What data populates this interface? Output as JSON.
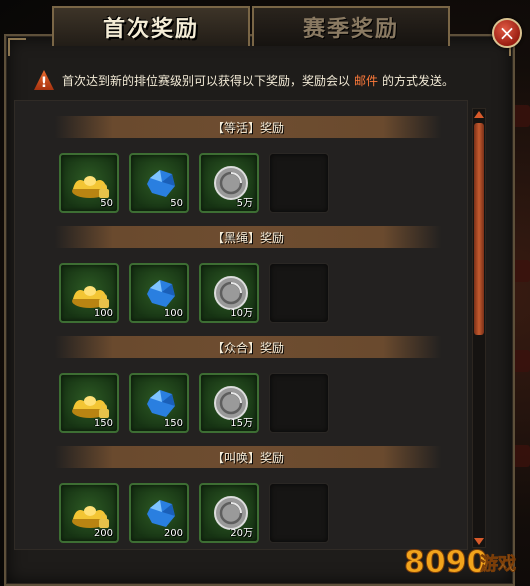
{
  "tabs": [
    {
      "label": "首次奖励",
      "active": true
    },
    {
      "label": "赛季奖励",
      "active": false
    }
  ],
  "close": {
    "glyph": "×"
  },
  "notice": {
    "pre": "首次达到新的排位赛级别可以获得以下奖励，奖励会以",
    "highlight": "邮件",
    "post": "的方式发送。",
    "highlight_color": "#ff7a3a"
  },
  "sections": [
    {
      "title": "【等活】奖励",
      "rewards": [
        {
          "icon": "gold-ingot-icon",
          "qty": "50",
          "locked": true
        },
        {
          "icon": "blue-crystal-icon",
          "qty": "50"
        },
        {
          "icon": "silver-coin-icon",
          "qty": "5万"
        }
      ]
    },
    {
      "title": "【黑绳】奖励",
      "rewards": [
        {
          "icon": "gold-ingot-icon",
          "qty": "100",
          "locked": true
        },
        {
          "icon": "blue-crystal-icon",
          "qty": "100"
        },
        {
          "icon": "silver-coin-icon",
          "qty": "10万"
        }
      ]
    },
    {
      "title": "【众合】奖励",
      "rewards": [
        {
          "icon": "gold-ingot-icon",
          "qty": "150",
          "locked": true
        },
        {
          "icon": "blue-crystal-icon",
          "qty": "150"
        },
        {
          "icon": "silver-coin-icon",
          "qty": "15万"
        }
      ]
    },
    {
      "title": "【叫唤】奖励",
      "rewards": [
        {
          "icon": "gold-ingot-icon",
          "qty": "200",
          "locked": true
        },
        {
          "icon": "blue-crystal-icon",
          "qty": "200"
        },
        {
          "icon": "silver-coin-icon",
          "qty": "20万"
        }
      ]
    }
  ],
  "watermark": {
    "digits": "8090",
    "suffix": "游戏"
  },
  "colors": {
    "accent": "#d85a2a",
    "frame": "#7a6646",
    "slot_border": "#3d6e33"
  }
}
